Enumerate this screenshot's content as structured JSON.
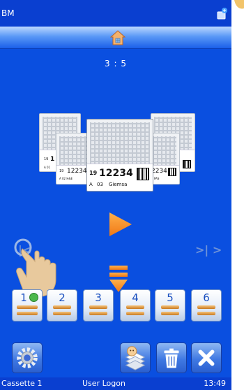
{
  "status_bar": {
    "app_title": "BM"
  },
  "counter": "3 : 5",
  "cassettes": {
    "back_left": {
      "num": "19",
      "code": "1",
      "line2": "A 01"
    },
    "mid_left": {
      "num": "19",
      "code": "12234",
      "line2": "A 02 H&E"
    },
    "front": {
      "num": "19",
      "code": "12234",
      "block": "A",
      "level": "03",
      "stain": "Giemsa"
    },
    "mid_right": {
      "code": "2234",
      "line2": "PAS"
    }
  },
  "navigation": {
    "prev": "|<",
    "next": ">| >"
  },
  "slots": [
    {
      "label": "1",
      "active": true
    },
    {
      "label": "2"
    },
    {
      "label": "3"
    },
    {
      "label": "4"
    },
    {
      "label": "5"
    },
    {
      "label": "6"
    }
  ],
  "status_bottom": {
    "cassette": "Cassette 1",
    "user": "User Logon",
    "time": "13:49"
  },
  "colors": {
    "background": "#0a4fe0",
    "accent_orange": "#f28a1c",
    "bar": "#0a3fd0"
  },
  "icons": [
    "sync-icon",
    "home-icon",
    "play-icon",
    "hand-pointer-icon",
    "double-down-icon",
    "settings-icon",
    "stack-icon",
    "trash-icon",
    "close-icon"
  ]
}
